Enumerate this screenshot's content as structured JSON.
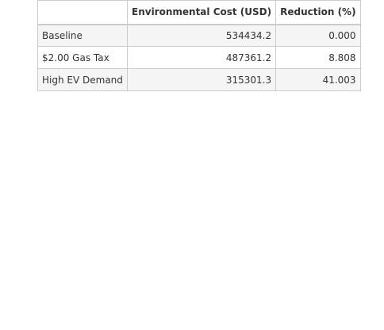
{
  "table": {
    "corner_label": "",
    "columns": [
      "Environmental Cost (USD)",
      "Reduction (%)"
    ],
    "rows": [
      {
        "label": "Baseline",
        "cells": [
          "534434.2",
          "0.000"
        ]
      },
      {
        "label": "$2.00 Gas Tax",
        "cells": [
          "487361.2",
          "8.808"
        ]
      },
      {
        "label": "High EV Demand",
        "cells": [
          "315301.3",
          "41.003"
        ]
      }
    ]
  },
  "colors": {
    "border": "#cccccc",
    "stripe": "#f5f5f5",
    "text": "#333333"
  }
}
